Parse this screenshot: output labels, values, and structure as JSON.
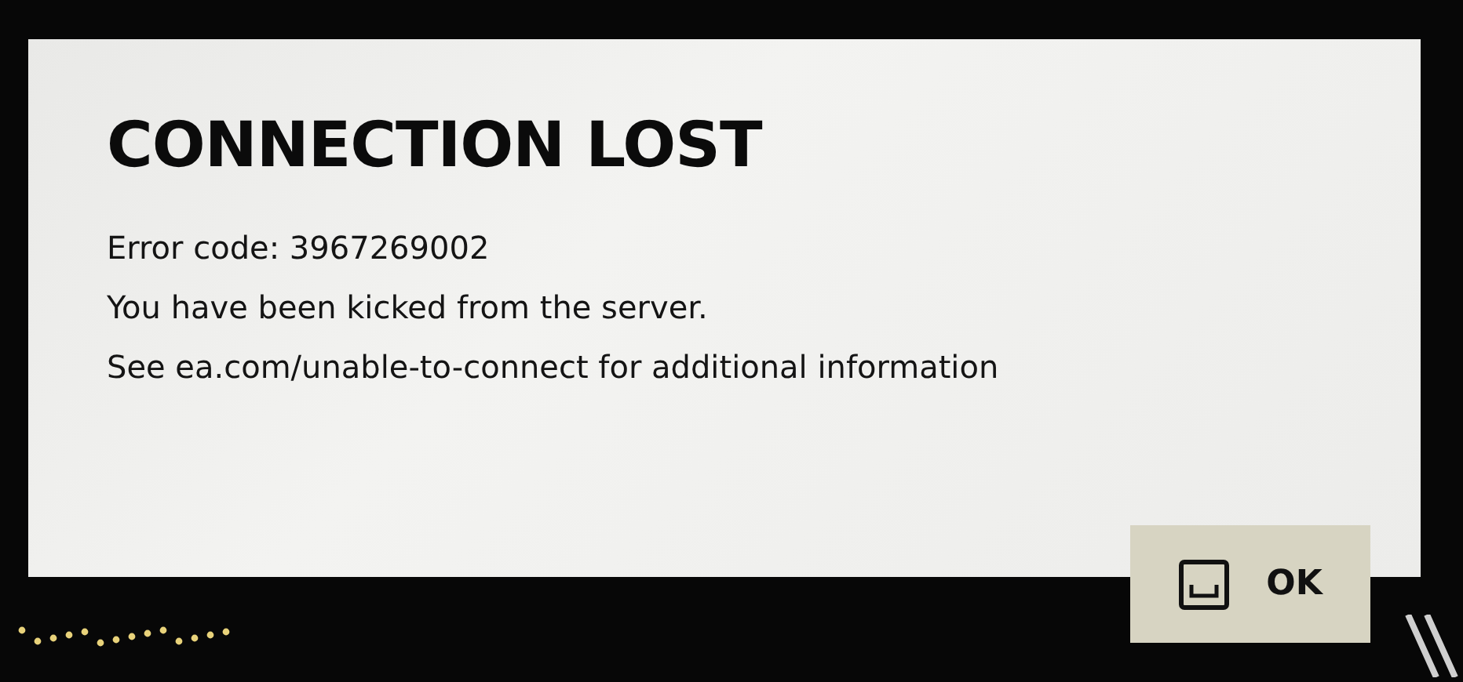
{
  "dialog": {
    "title": "CONNECTION LOST",
    "lines": [
      "Error code: 3967269002",
      "You have been kicked from the server.",
      "See ea.com/unable-to-connect for additional information"
    ]
  },
  "button": {
    "label": "OK"
  }
}
